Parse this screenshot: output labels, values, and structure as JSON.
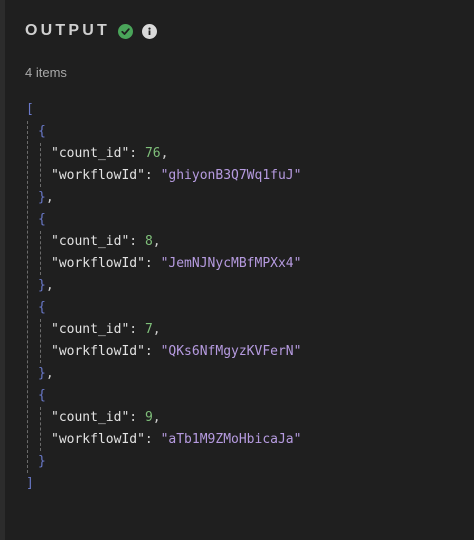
{
  "header": {
    "title": "OUTPUT",
    "status_icon": "check-circle-icon",
    "info_icon": "info-icon"
  },
  "summary": {
    "count_text": "4 items"
  },
  "output": {
    "open_bracket": "[",
    "close_bracket": "]",
    "items": [
      {
        "count_id_key": "\"count_id\"",
        "count_id": "76",
        "workflow_key": "\"workflowId\"",
        "workflowId": "\"ghiyonB3Q7Wq1fuJ\""
      },
      {
        "count_id_key": "\"count_id\"",
        "count_id": "8",
        "workflow_key": "\"workflowId\"",
        "workflowId": "\"JemNJNycMBfMPXx4\""
      },
      {
        "count_id_key": "\"count_id\"",
        "count_id": "7",
        "workflow_key": "\"workflowId\"",
        "workflowId": "\"QKs6NfMgyzKVFerN\""
      },
      {
        "count_id_key": "\"count_id\"",
        "count_id": "9",
        "workflow_key": "\"workflowId\"",
        "workflowId": "\"aTb1M9ZMoHbicaJa\""
      }
    ]
  },
  "colors": {
    "background": "#1f1f1f",
    "brackets": "#6a79c9",
    "numbers": "#7fbf7a",
    "strings": "#b69be0",
    "success": "#4aa55a"
  }
}
